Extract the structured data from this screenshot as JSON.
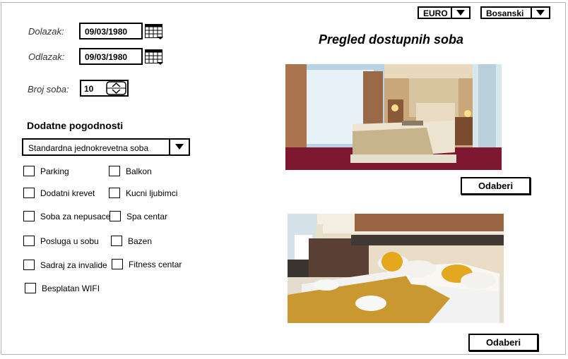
{
  "header": {
    "currency": {
      "selected": "EURO"
    },
    "language": {
      "selected": "Bosanski"
    }
  },
  "booking": {
    "arrival": {
      "label": "Dolazak:",
      "value": "09/03/1980"
    },
    "departure": {
      "label": "Odlazak:",
      "value": "09/03/1980"
    },
    "rooms": {
      "label": "Broj soba:",
      "value": "10"
    }
  },
  "amenities": {
    "title": "Dodatne pogodnosti",
    "room_type": "Standardna jednokrevetna soba",
    "options": [
      "Parking",
      "Balkon",
      "Dodatni krevet",
      "Kucni ljubimci",
      "Soba za nepusace",
      "Spa centar",
      "Posluga u sobu",
      "Bazen",
      "Sadraj za invalide",
      "Fitness centar",
      "Besplatan WIFI"
    ]
  },
  "rooms_panel": {
    "title": "Pregled dostupnih soba",
    "rooms": [
      {
        "button": "Odaberi"
      },
      {
        "button": "Odaberi"
      }
    ]
  },
  "icons": {
    "calendar": "calendar-icon",
    "dropdown": "chevron-down-icon",
    "stepper": "up-down-arrows-icon"
  }
}
